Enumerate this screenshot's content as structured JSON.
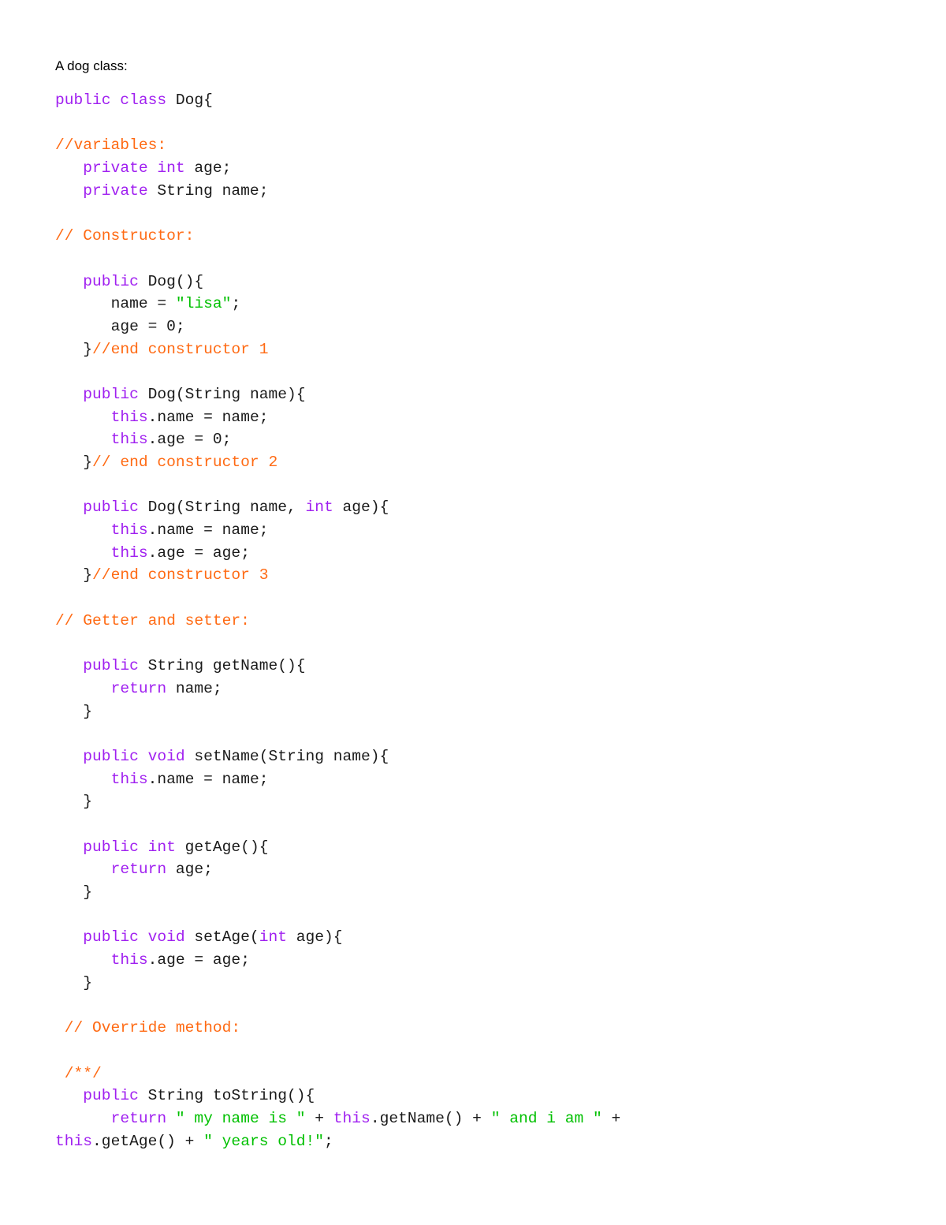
{
  "colors": {
    "keyword": "#a020f0",
    "comment": "#ff6a13",
    "string": "#00c000",
    "plain": "#1a1a1a"
  },
  "document": {
    "heading": "A dog class:",
    "lines": [
      {
        "indent": 0,
        "tokens": [
          [
            "kw",
            "public class"
          ],
          [
            "pl",
            " Dog{"
          ]
        ]
      },
      {
        "indent": 0,
        "tokens": []
      },
      {
        "indent": 0,
        "tokens": [
          [
            "cm",
            "//variables:"
          ]
        ]
      },
      {
        "indent": 3,
        "tokens": [
          [
            "kw",
            "private int"
          ],
          [
            "pl",
            " age;"
          ]
        ]
      },
      {
        "indent": 3,
        "tokens": [
          [
            "kw",
            "private"
          ],
          [
            "pl",
            " String name;"
          ]
        ]
      },
      {
        "indent": 0,
        "tokens": []
      },
      {
        "indent": 0,
        "tokens": [
          [
            "cm",
            "// Constructor:"
          ]
        ]
      },
      {
        "indent": 0,
        "tokens": []
      },
      {
        "indent": 3,
        "tokens": [
          [
            "kw",
            "public"
          ],
          [
            "pl",
            " Dog(){"
          ]
        ]
      },
      {
        "indent": 6,
        "tokens": [
          [
            "pl",
            "name = "
          ],
          [
            "st",
            "\"lisa\""
          ],
          [
            "pl",
            ";"
          ]
        ]
      },
      {
        "indent": 6,
        "tokens": [
          [
            "pl",
            "age = 0;"
          ]
        ]
      },
      {
        "indent": 3,
        "tokens": [
          [
            "pl",
            "}"
          ],
          [
            "cm",
            "//end constructor 1"
          ]
        ]
      },
      {
        "indent": 0,
        "tokens": []
      },
      {
        "indent": 3,
        "tokens": [
          [
            "kw",
            "public"
          ],
          [
            "pl",
            " Dog(String name){"
          ]
        ]
      },
      {
        "indent": 6,
        "tokens": [
          [
            "kw",
            "this"
          ],
          [
            "pl",
            ".name = name;"
          ]
        ]
      },
      {
        "indent": 6,
        "tokens": [
          [
            "kw",
            "this"
          ],
          [
            "pl",
            ".age = 0;"
          ]
        ]
      },
      {
        "indent": 3,
        "tokens": [
          [
            "pl",
            "}"
          ],
          [
            "cm",
            "// end constructor 2"
          ]
        ]
      },
      {
        "indent": 0,
        "tokens": []
      },
      {
        "indent": 3,
        "tokens": [
          [
            "kw",
            "public"
          ],
          [
            "pl",
            " Dog(String name, "
          ],
          [
            "kw",
            "int"
          ],
          [
            "pl",
            " age){"
          ]
        ]
      },
      {
        "indent": 6,
        "tokens": [
          [
            "kw",
            "this"
          ],
          [
            "pl",
            ".name = name;"
          ]
        ]
      },
      {
        "indent": 6,
        "tokens": [
          [
            "kw",
            "this"
          ],
          [
            "pl",
            ".age = age;"
          ]
        ]
      },
      {
        "indent": 3,
        "tokens": [
          [
            "pl",
            "}"
          ],
          [
            "cm",
            "//end constructor 3"
          ]
        ]
      },
      {
        "indent": 0,
        "tokens": []
      },
      {
        "indent": 0,
        "tokens": [
          [
            "cm",
            "// Getter and setter:"
          ]
        ]
      },
      {
        "indent": 0,
        "tokens": []
      },
      {
        "indent": 3,
        "tokens": [
          [
            "kw",
            "public"
          ],
          [
            "pl",
            " String getName(){"
          ]
        ]
      },
      {
        "indent": 6,
        "tokens": [
          [
            "kw",
            "return"
          ],
          [
            "pl",
            " name;"
          ]
        ]
      },
      {
        "indent": 3,
        "tokens": [
          [
            "pl",
            "}"
          ]
        ]
      },
      {
        "indent": 0,
        "tokens": []
      },
      {
        "indent": 3,
        "tokens": [
          [
            "kw",
            "public void"
          ],
          [
            "pl",
            " setName(String name){"
          ]
        ]
      },
      {
        "indent": 6,
        "tokens": [
          [
            "kw",
            "this"
          ],
          [
            "pl",
            ".name = name;"
          ]
        ]
      },
      {
        "indent": 3,
        "tokens": [
          [
            "pl",
            "}"
          ]
        ]
      },
      {
        "indent": 0,
        "tokens": []
      },
      {
        "indent": 3,
        "tokens": [
          [
            "kw",
            "public int"
          ],
          [
            "pl",
            " getAge(){"
          ]
        ]
      },
      {
        "indent": 6,
        "tokens": [
          [
            "kw",
            "return"
          ],
          [
            "pl",
            " age;"
          ]
        ]
      },
      {
        "indent": 3,
        "tokens": [
          [
            "pl",
            "}"
          ]
        ]
      },
      {
        "indent": 0,
        "tokens": []
      },
      {
        "indent": 3,
        "tokens": [
          [
            "kw",
            "public void"
          ],
          [
            "pl",
            " setAge("
          ],
          [
            "kw",
            "int"
          ],
          [
            "pl",
            " age){"
          ]
        ]
      },
      {
        "indent": 6,
        "tokens": [
          [
            "kw",
            "this"
          ],
          [
            "pl",
            ".age = age;"
          ]
        ]
      },
      {
        "indent": 3,
        "tokens": [
          [
            "pl",
            "}"
          ]
        ]
      },
      {
        "indent": 0,
        "tokens": []
      },
      {
        "indent": 1,
        "tokens": [
          [
            "cm",
            "// Override method:"
          ]
        ]
      },
      {
        "indent": 0,
        "tokens": []
      },
      {
        "indent": 1,
        "tokens": [
          [
            "cm",
            "/**/"
          ]
        ]
      },
      {
        "indent": 3,
        "tokens": [
          [
            "kw",
            "public"
          ],
          [
            "pl",
            " String toString(){"
          ]
        ]
      },
      {
        "indent": 6,
        "tokens": [
          [
            "kw",
            "return"
          ],
          [
            "st",
            " \" my name is \""
          ],
          [
            "pl",
            " + "
          ],
          [
            "kw",
            "this"
          ],
          [
            "pl",
            ".getName() + "
          ],
          [
            "st",
            "\" and i am \""
          ],
          [
            "pl",
            " +"
          ]
        ]
      },
      {
        "indent": 0,
        "tokens": [
          [
            "kw",
            "this"
          ],
          [
            "pl",
            ".getAge() + "
          ],
          [
            "st",
            "\" years old!\""
          ],
          [
            "pl",
            ";"
          ]
        ]
      }
    ]
  }
}
